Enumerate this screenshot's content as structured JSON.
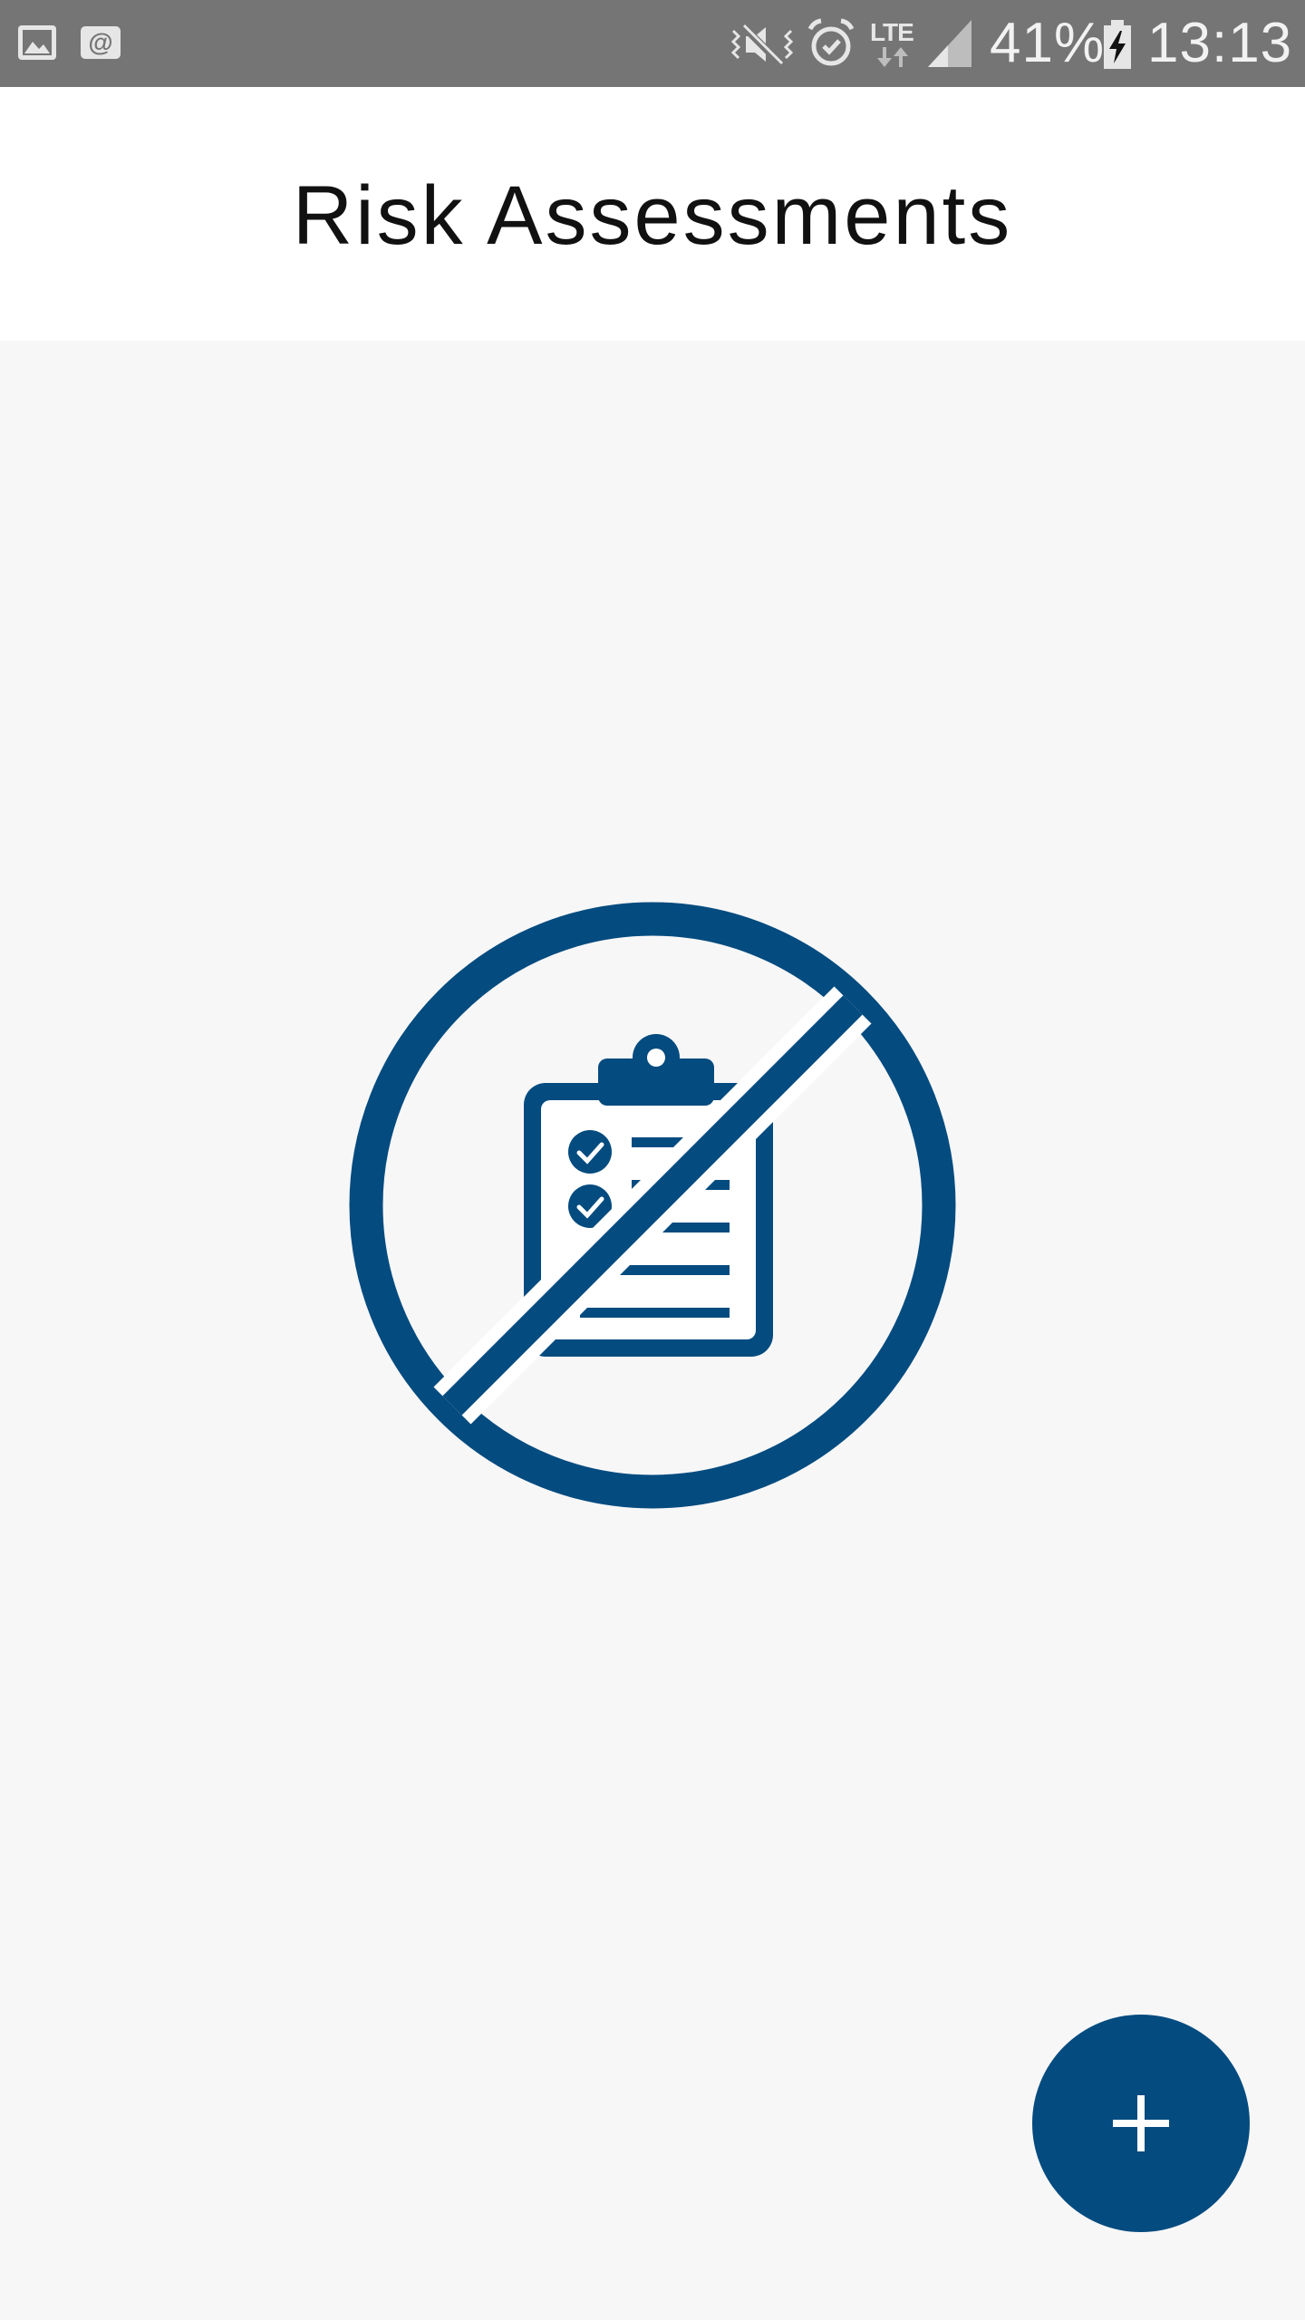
{
  "status_bar": {
    "battery_percent": "41%",
    "time": "13:13",
    "network": "LTE",
    "icons": [
      "gallery-icon",
      "email-icon",
      "mute-icon",
      "alarm-icon",
      "lte-icon",
      "signal-icon",
      "battery-charging-icon"
    ]
  },
  "header": {
    "title": "Risk Assessments"
  },
  "empty_state": {
    "icon": "no-assessments-icon"
  },
  "fab": {
    "icon": "plus-icon"
  },
  "colors": {
    "status_bar": "#757575",
    "header_bg": "#ffffff",
    "content_bg": "#f7f7f8",
    "accent": "#044b7f",
    "title_text": "#111111"
  }
}
